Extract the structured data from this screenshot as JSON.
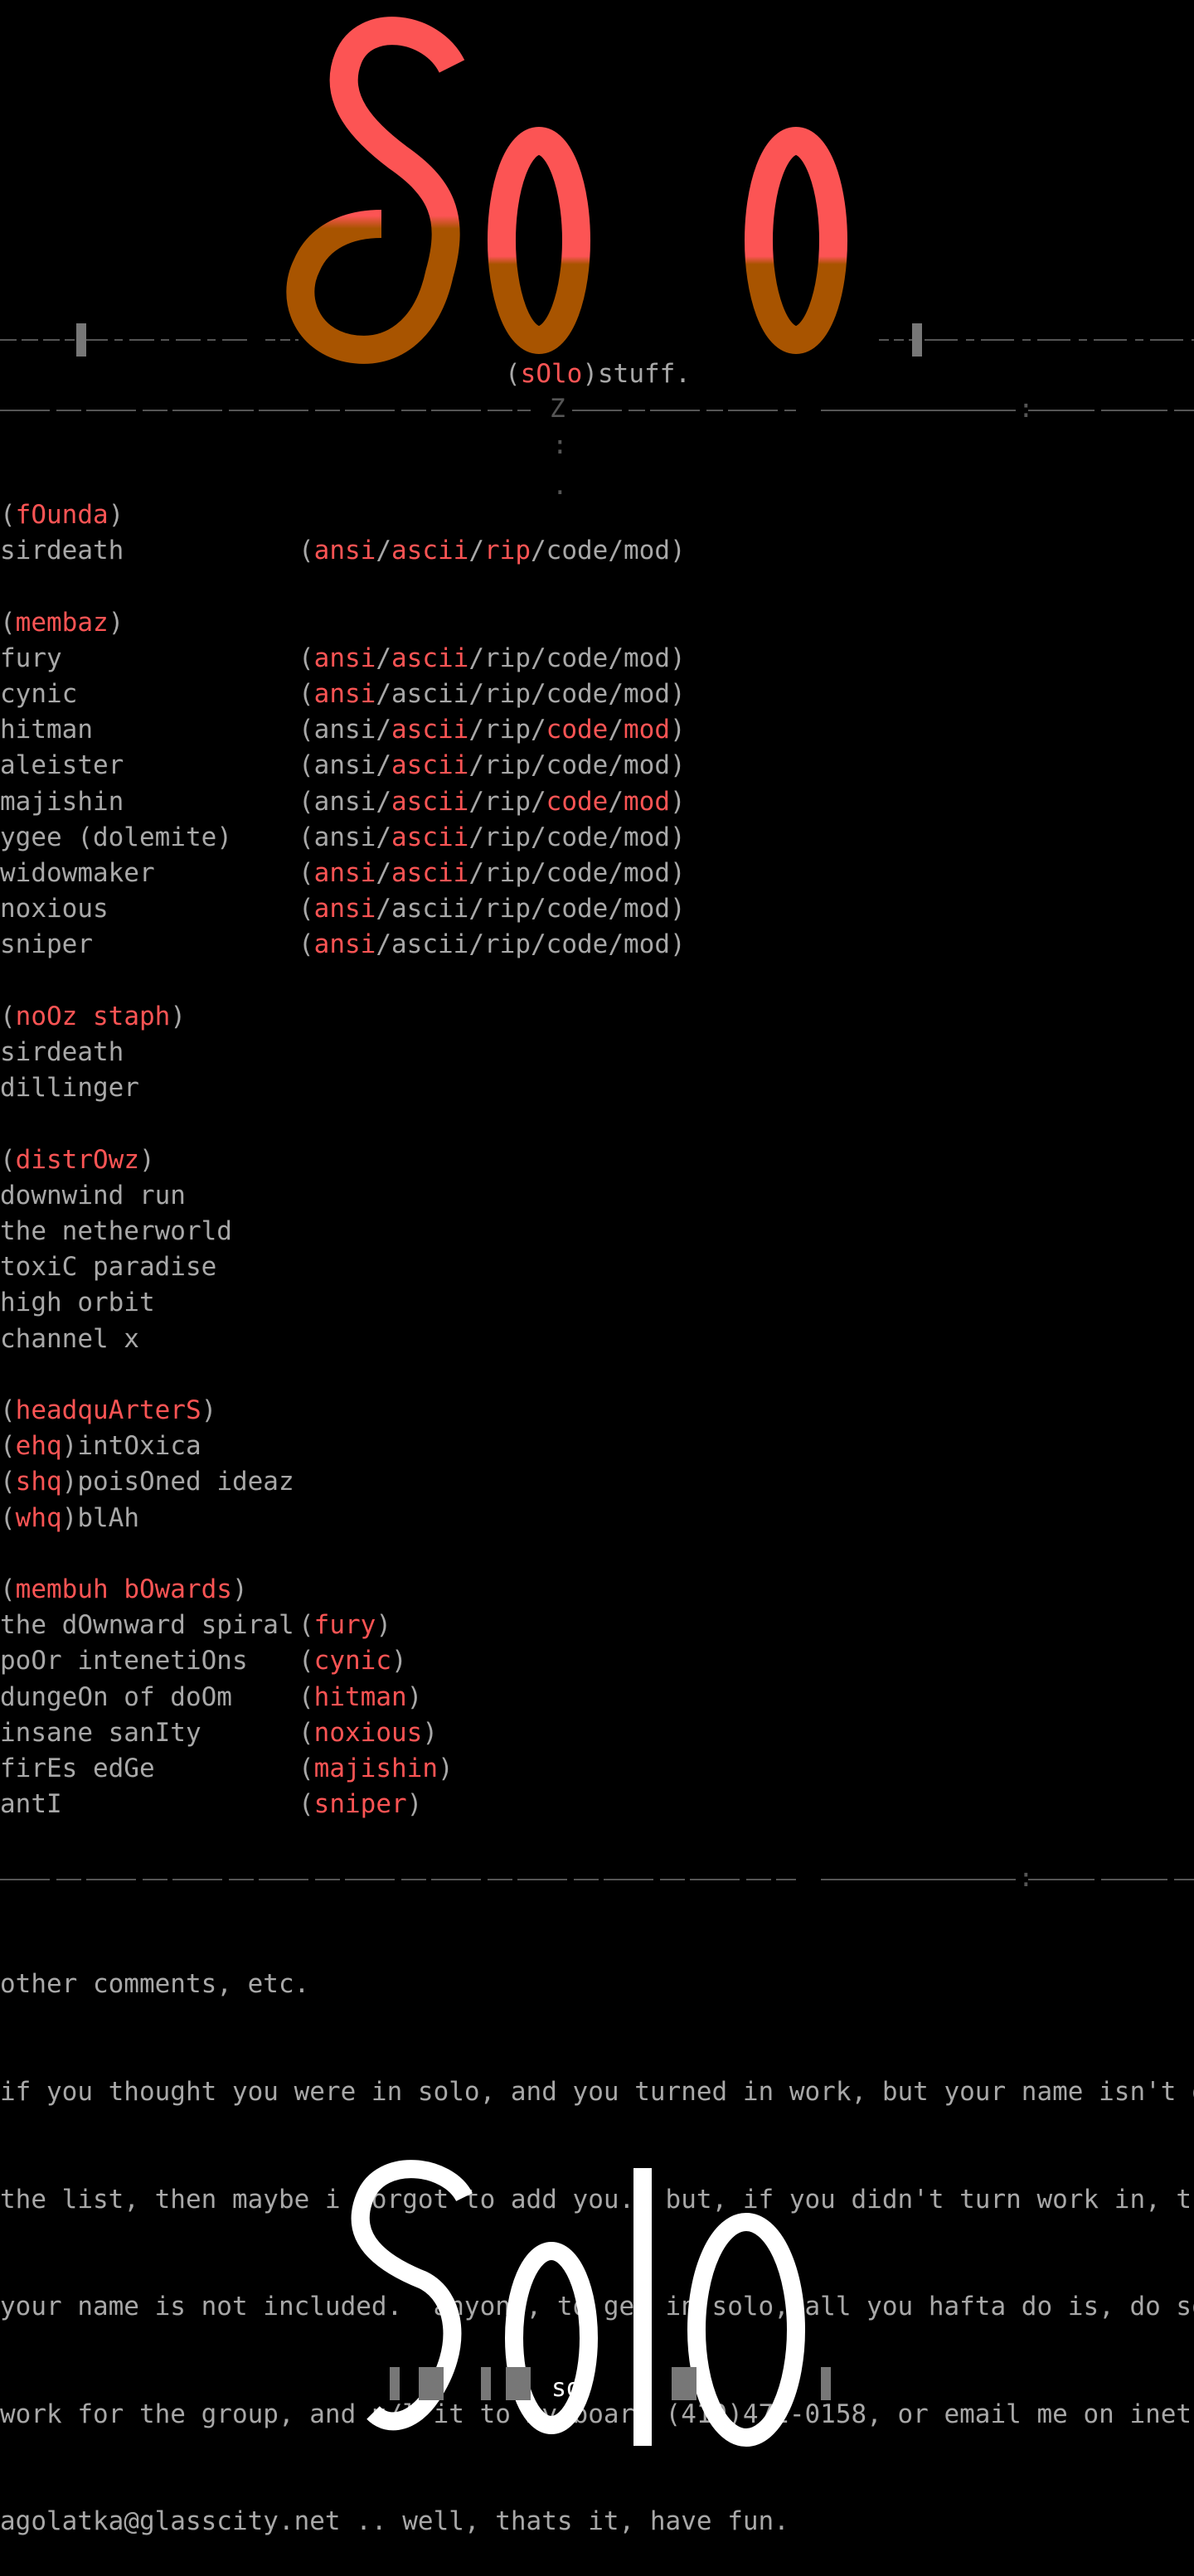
{
  "header": {
    "tagline_open": "(",
    "tagline_name": "sOlo",
    "tagline_close": ")stuff.",
    "divider_mark": "Z",
    "dot1": ":",
    "dot2": "."
  },
  "colors": {
    "accent": "#fc5454",
    "text": "#a8a8a8",
    "background": "#000000"
  },
  "founda": {
    "label": "fOunda",
    "members": [
      {
        "name": "sirdeath",
        "roles": [
          "ansi",
          "ascii",
          "rip",
          "code",
          "mod"
        ],
        "highlight": [
          true,
          true,
          true,
          false,
          false
        ]
      }
    ]
  },
  "membaz": {
    "label": "membaz",
    "members": [
      {
        "name": "fury",
        "roles": [
          "ansi",
          "ascii",
          "rip",
          "code",
          "mod"
        ],
        "highlight": [
          true,
          true,
          false,
          false,
          false
        ]
      },
      {
        "name": "cynic",
        "roles": [
          "ansi",
          "ascii",
          "rip",
          "code",
          "mod"
        ],
        "highlight": [
          true,
          false,
          false,
          false,
          false
        ]
      },
      {
        "name": "hitman",
        "roles": [
          "ansi",
          "ascii",
          "rip",
          "code",
          "mod"
        ],
        "highlight": [
          false,
          true,
          false,
          true,
          true
        ]
      },
      {
        "name": "aleister",
        "roles": [
          "ansi",
          "ascii",
          "rip",
          "code",
          "mod"
        ],
        "highlight": [
          false,
          true,
          false,
          false,
          false
        ]
      },
      {
        "name": "majishin",
        "roles": [
          "ansi",
          "ascii",
          "rip",
          "code",
          "mod"
        ],
        "highlight": [
          false,
          true,
          false,
          true,
          true
        ]
      },
      {
        "name": "ygee (dolemite)",
        "roles": [
          "ansi",
          "ascii",
          "rip",
          "code",
          "mod"
        ],
        "highlight": [
          false,
          true,
          false,
          false,
          false
        ]
      },
      {
        "name": "widowmaker",
        "roles": [
          "ansi",
          "ascii",
          "rip",
          "code",
          "mod"
        ],
        "highlight": [
          true,
          true,
          false,
          false,
          false
        ]
      },
      {
        "name": "noxious",
        "roles": [
          "ansi",
          "ascii",
          "rip",
          "code",
          "mod"
        ],
        "highlight": [
          true,
          false,
          false,
          false,
          false
        ]
      },
      {
        "name": "sniper",
        "roles": [
          "ansi",
          "ascii",
          "rip",
          "code",
          "mod"
        ],
        "highlight": [
          true,
          false,
          false,
          false,
          false
        ]
      }
    ]
  },
  "nooz_staph": {
    "label": "noOz staph",
    "items": [
      "sirdeath",
      "dillinger"
    ]
  },
  "distros": {
    "label": "distrOwz",
    "items": [
      "downwind run",
      "the netherworld",
      "toxiC paradise",
      "high orbit",
      "channel x"
    ]
  },
  "headquarters": {
    "label": "headquArterS",
    "items": [
      {
        "tag": "ehq",
        "name": "intOxica"
      },
      {
        "tag": "shq",
        "name": "poisOned ideaz"
      },
      {
        "tag": "whq",
        "name": "blAh"
      }
    ]
  },
  "member_boards": {
    "label": "membuh bOwards",
    "items": [
      {
        "board": "the dOwnward spiral",
        "owner": "fury"
      },
      {
        "board": "poOr intenetiOns",
        "owner": "cynic"
      },
      {
        "board": "dungeOn of doOm",
        "owner": "hitman"
      },
      {
        "board": "insane sanIty",
        "owner": "noxious"
      },
      {
        "board": "firEs edGe",
        "owner": "majishin"
      },
      {
        "board": "antI",
        "owner": "sniper"
      }
    ]
  },
  "comments": {
    "title": "other comments, etc.",
    "lines": [
      "if you thought you were in solo, and you turned in work, but your name isn't on",
      "the list, then maybe i forgot to add you.  but, if you didn't turn work in, then",
      "your name is not included.  anyone, to get in solo, all you hafta do is, do some",
      "work for the group, and u/l it to my board (419)472-0158, or email me on inet at",
      "agolatka@glasscity.net .. well, thats it, have fun."
    ]
  },
  "footer": {
    "signature": "sd"
  }
}
